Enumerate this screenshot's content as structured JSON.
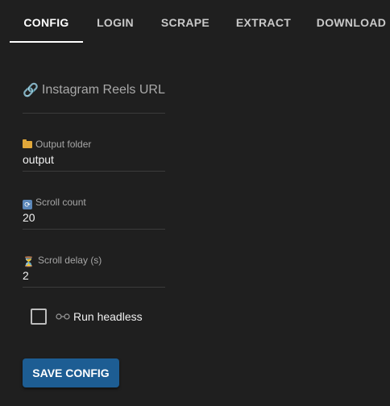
{
  "tabs": [
    {
      "label": "CONFIG",
      "active": true
    },
    {
      "label": "LOGIN",
      "active": false
    },
    {
      "label": "SCRAPE",
      "active": false
    },
    {
      "label": "EXTRACT",
      "active": false
    },
    {
      "label": "DOWNLOAD",
      "active": false
    }
  ],
  "form": {
    "url": {
      "placeholder": "Instagram Reels URL",
      "value": "",
      "icon": "link-icon"
    },
    "output_folder": {
      "label": "Output folder",
      "value": "output",
      "icon": "folder-icon"
    },
    "scroll_count": {
      "label": "Scroll count",
      "value": "20",
      "icon": "refresh-icon"
    },
    "scroll_delay": {
      "label": "Scroll delay (s)",
      "value": "2",
      "icon": "hourglass-icon"
    },
    "headless": {
      "label": "Run headless",
      "checked": false,
      "icon": "glasses-icon"
    }
  },
  "actions": {
    "save_label": "SAVE CONFIG"
  },
  "colors": {
    "background": "#1f1f1f",
    "button": "#1d5d93",
    "active_tab": "#ffffff"
  }
}
